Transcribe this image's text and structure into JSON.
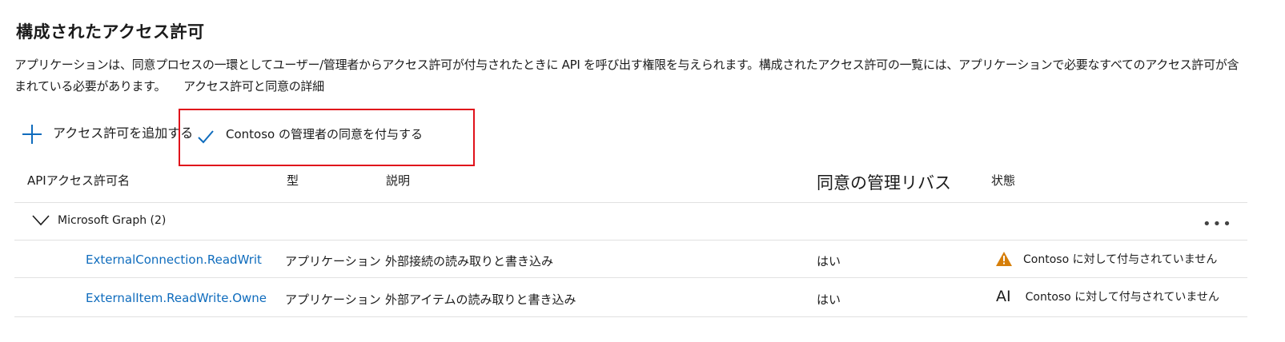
{
  "page": {
    "title": "構成されたアクセス許可",
    "description": "アプリケーションは、同意プロセスの一環としてユーザー/管理者からアクセス許可が付与されたときに API を呼び出す権限を与えられます。構成されたアクセス許可の一覧には、アプリケーションで必要なすべてのアクセス許可が含まれている必要があります。",
    "learn_more": "アクセス許可と同意の詳細"
  },
  "toolbar": {
    "add_permission": "アクセス許可を追加する",
    "grant_consent": "Contoso の管理者の同意を付与する"
  },
  "table": {
    "headers": {
      "name": "APIアクセス許可名",
      "type": "型",
      "description": "説明",
      "admin_consent": "同意の管理リバス",
      "status": "状態"
    },
    "group": {
      "label": "Microsoft Graph (2)"
    },
    "rows": [
      {
        "name": "ExternalConnection.ReadWrit",
        "type": "アプリケーション",
        "description": "外部接続の読み取りと書き込み",
        "admin_consent": "はい",
        "status": "Contoso に対して付与されていません",
        "status_icon": "warning-icon"
      },
      {
        "name": "ExternalItem.ReadWrite.Owne",
        "type": "アプリケーション",
        "description": "外部アイテムの読み取りと書き込み",
        "admin_consent": "はい",
        "status": "Contoso に対して付与されていません",
        "status_icon_text": "AI"
      }
    ]
  },
  "colors": {
    "accent": "#0f6cbd",
    "highlight": "#e0121b",
    "warning": "#d67f0a"
  }
}
